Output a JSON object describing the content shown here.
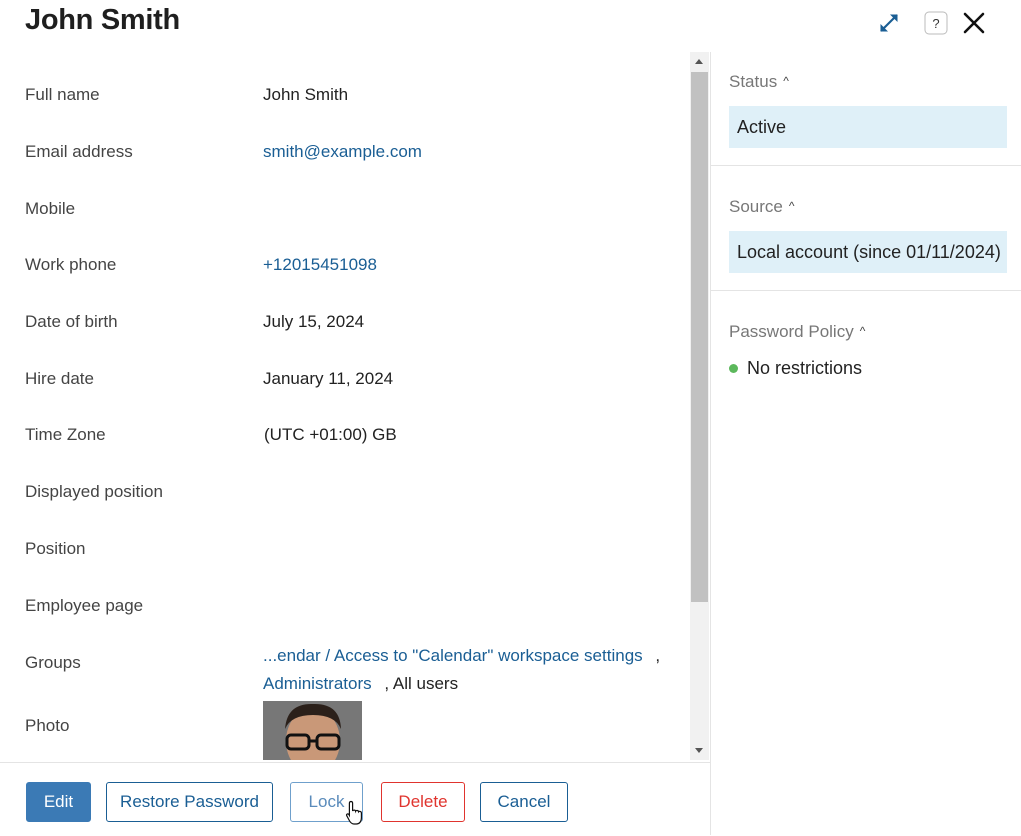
{
  "header": {
    "title": "John Smith",
    "icons": [
      "expand-icon",
      "help-icon",
      "close-icon"
    ]
  },
  "fields": [
    {
      "label": "Full name",
      "value": "John Smith",
      "type": "text"
    },
    {
      "label": "Email address",
      "value": "smith@example.com",
      "type": "link"
    },
    {
      "label": "Mobile",
      "value": "",
      "type": "text"
    },
    {
      "label": "Work phone",
      "value": "+12015451098",
      "type": "link"
    },
    {
      "label": "Date of birth",
      "value": "July 15, 2024",
      "type": "text"
    },
    {
      "label": "Hire date",
      "value": "January 11, 2024",
      "type": "text"
    },
    {
      "label": "Time Zone",
      "value": "(UTC +01:00) GB",
      "type": "text"
    },
    {
      "label": "Displayed position",
      "value": "",
      "type": "text"
    },
    {
      "label": "Position",
      "value": "",
      "type": "text"
    },
    {
      "label": "Employee page",
      "value": "",
      "type": "text"
    },
    {
      "label": "Groups",
      "value": "",
      "type": "groups"
    },
    {
      "label": "Photo",
      "value": "",
      "type": "photo"
    }
  ],
  "groups": {
    "item1": "...endar / Access to \"Calendar\" workspace settings",
    "sep1": ",",
    "item2": "Administrators",
    "sep2": ",",
    "item3": "All users"
  },
  "footer": {
    "edit": "Edit",
    "restore_password": "Restore Password",
    "lock": "Lock",
    "delete": "Delete",
    "cancel": "Cancel"
  },
  "sidebar": {
    "status": {
      "title": "Status",
      "value": "Active"
    },
    "source": {
      "title": "Source",
      "value": "Local account (since 01/11/2024)"
    },
    "password_policy": {
      "title": "Password Policy",
      "value": "No restrictions",
      "indicator_color": "#5cb85c"
    }
  },
  "colors": {
    "accent": "#1a5e94",
    "primary_button": "#3b7ab5",
    "danger": "#e0342e",
    "tag_background": "#dff0f8"
  }
}
